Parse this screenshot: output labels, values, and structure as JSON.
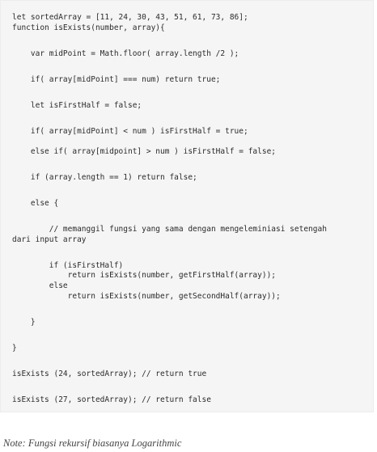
{
  "code": {
    "lines": [
      "let sortedArray = [11, 24, 30, 43, 51, 61, 73, 86];",
      "function isExists(number, array){",
      "    var midPoint = Math.floor( array.length /2 );",
      "    if( array[midPoint] === num) return true;",
      "    let isFirstHalf = false;",
      "    if( array[midPoint] < num ) isFirstHalf = true;",
      "    else if( array[midpoint] > num ) isFirstHalf = false;",
      "    if (array.length == 1) return false;",
      "    else {",
      "        // memanggil fungsi yang sama dengan mengeleminiasi setengah",
      "dari input array",
      "        if (isFirstHalf)",
      "            return isExists(number, getFirstHalf(array));",
      "        else",
      "            return isExists(number, getSecondHalf(array));",
      "    }",
      "}",
      "isExists (24, sortedArray); // return true",
      "isExists (27, sortedArray); // return false"
    ]
  },
  "note": "Note: Fungsi rekursif biasanya Logarithmic"
}
